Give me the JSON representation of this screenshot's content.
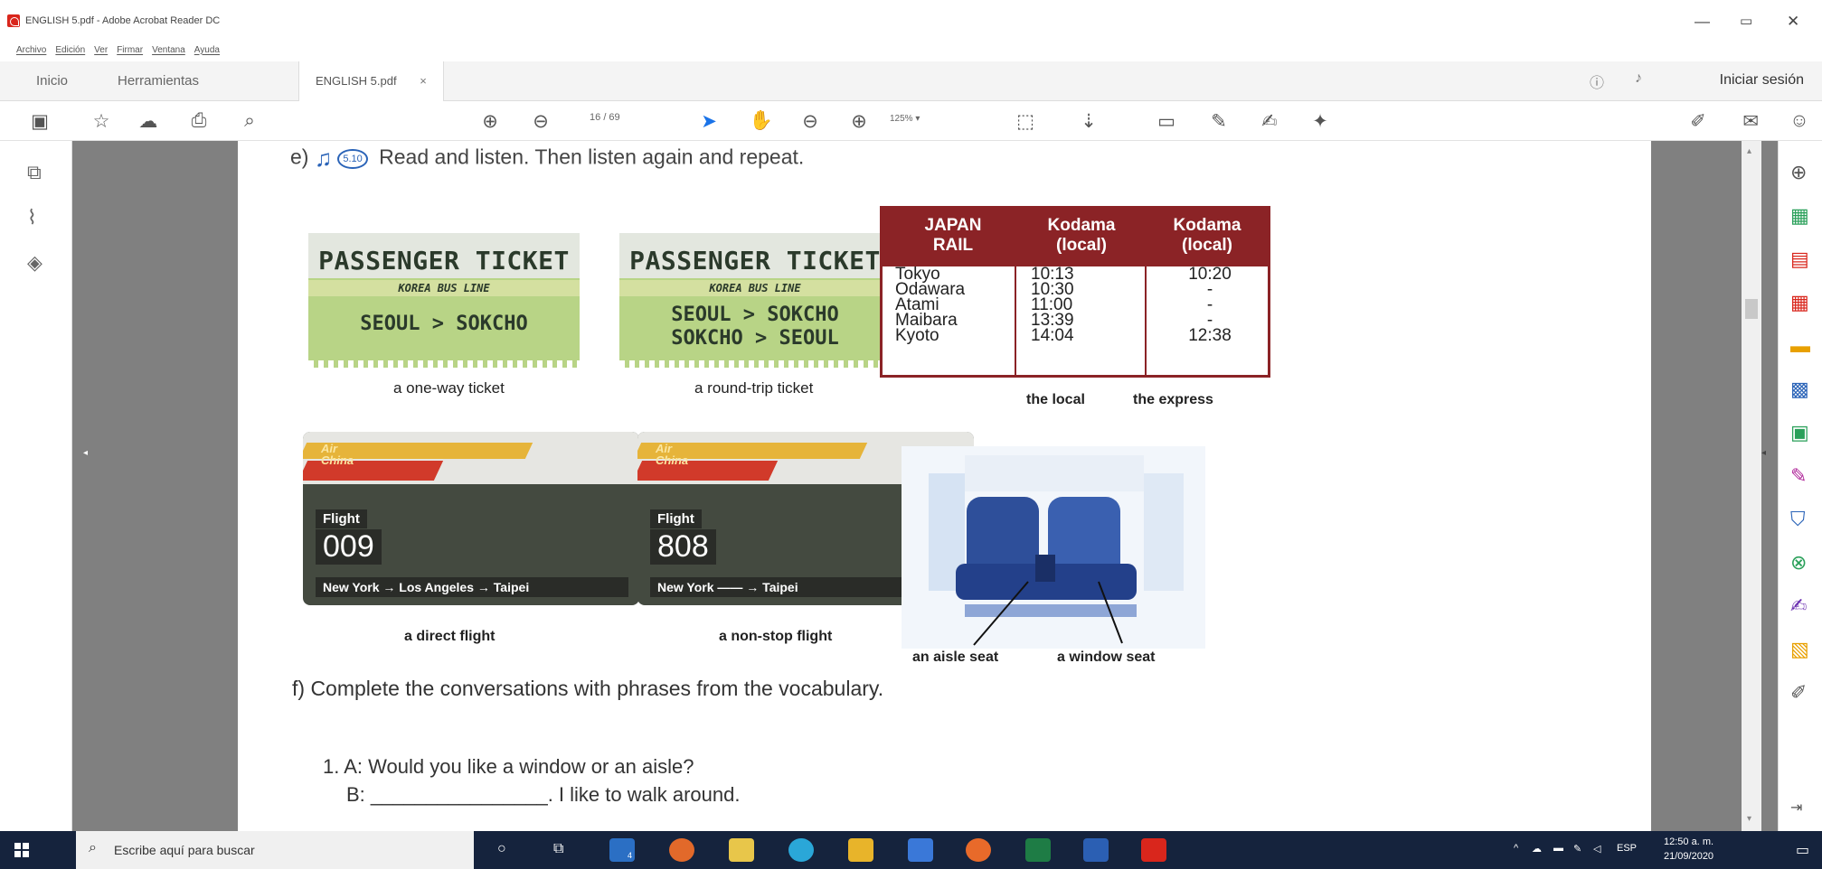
{
  "window": {
    "title": "ENGLISH 5.pdf - Adobe Acrobat Reader DC"
  },
  "menu": [
    "Archivo",
    "Edición",
    "Ver",
    "Firmar",
    "Ventana",
    "Ayuda"
  ],
  "tabs": {
    "home": "Inicio",
    "tools": "Herramientas",
    "doc": "ENGLISH 5.pdf",
    "close": "×",
    "signin": "Iniciar sesión"
  },
  "toolbar": {
    "page_current": "16",
    "page_total": "/ 69",
    "zoom": "125%"
  },
  "content": {
    "e_prefix": "e)",
    "e_badge": "5.10",
    "e_text": "Read and listen. Then listen again and repeat.",
    "ticket_title": "PASSENGER TICKET",
    "ticket_line": "KOREA BUS LINE",
    "ticket1_route": "SEOUL > SOKCHO",
    "ticket2_route1": "SEOUL > SOKCHO",
    "ticket2_route2": "SOKCHO > SEOUL",
    "cap_oneway": "a one-way ticket",
    "cap_roundtrip": "a round-trip ticket",
    "timetable": {
      "h1": [
        "JAPAN",
        "RAIL"
      ],
      "h2": [
        "Kodama",
        "(local)"
      ],
      "h3": [
        "Kodama",
        "(local)"
      ],
      "stations": [
        "Tokyo",
        "Odawara",
        "Atami",
        "Maibara",
        "Kyoto"
      ],
      "local_times": [
        "10:13",
        "10:30",
        "11:00",
        "13:39",
        "14:04"
      ],
      "express_times": [
        "10:20",
        "-",
        "-",
        "-",
        "12:38"
      ]
    },
    "cap_local": "the local",
    "cap_express": "the express",
    "airline": [
      "Air",
      "China"
    ],
    "flight_label": "Flight",
    "flight1_num": "009",
    "flight1_route": "New York → Los Angeles → Taipei",
    "flight2_num": "808",
    "flight2_route": "New York —— → Taipei",
    "cap_direct": "a direct flight",
    "cap_nonstop": "a non-stop flight",
    "cap_aisle": "an aisle seat",
    "cap_window": "a window seat",
    "f_text": "f) Complete the conversations with phrases from the vocabulary.",
    "q1_a": "1. A: Would you like a window or an aisle?",
    "q1_b_prefix": "B:",
    "q1_b_blank": "________________",
    "q1_b_suffix": ". I like to walk around."
  },
  "taskbar": {
    "search_placeholder": "Escribe aquí para buscar",
    "lang": "ESP",
    "time": "12:50 a. m.",
    "date": "21/09/2020",
    "badge": "4"
  },
  "colors": {
    "rail_red": "#8b2326",
    "ticket_green": "#b8d486",
    "taskbar": "#15233d",
    "doc_bg": "#808080"
  }
}
